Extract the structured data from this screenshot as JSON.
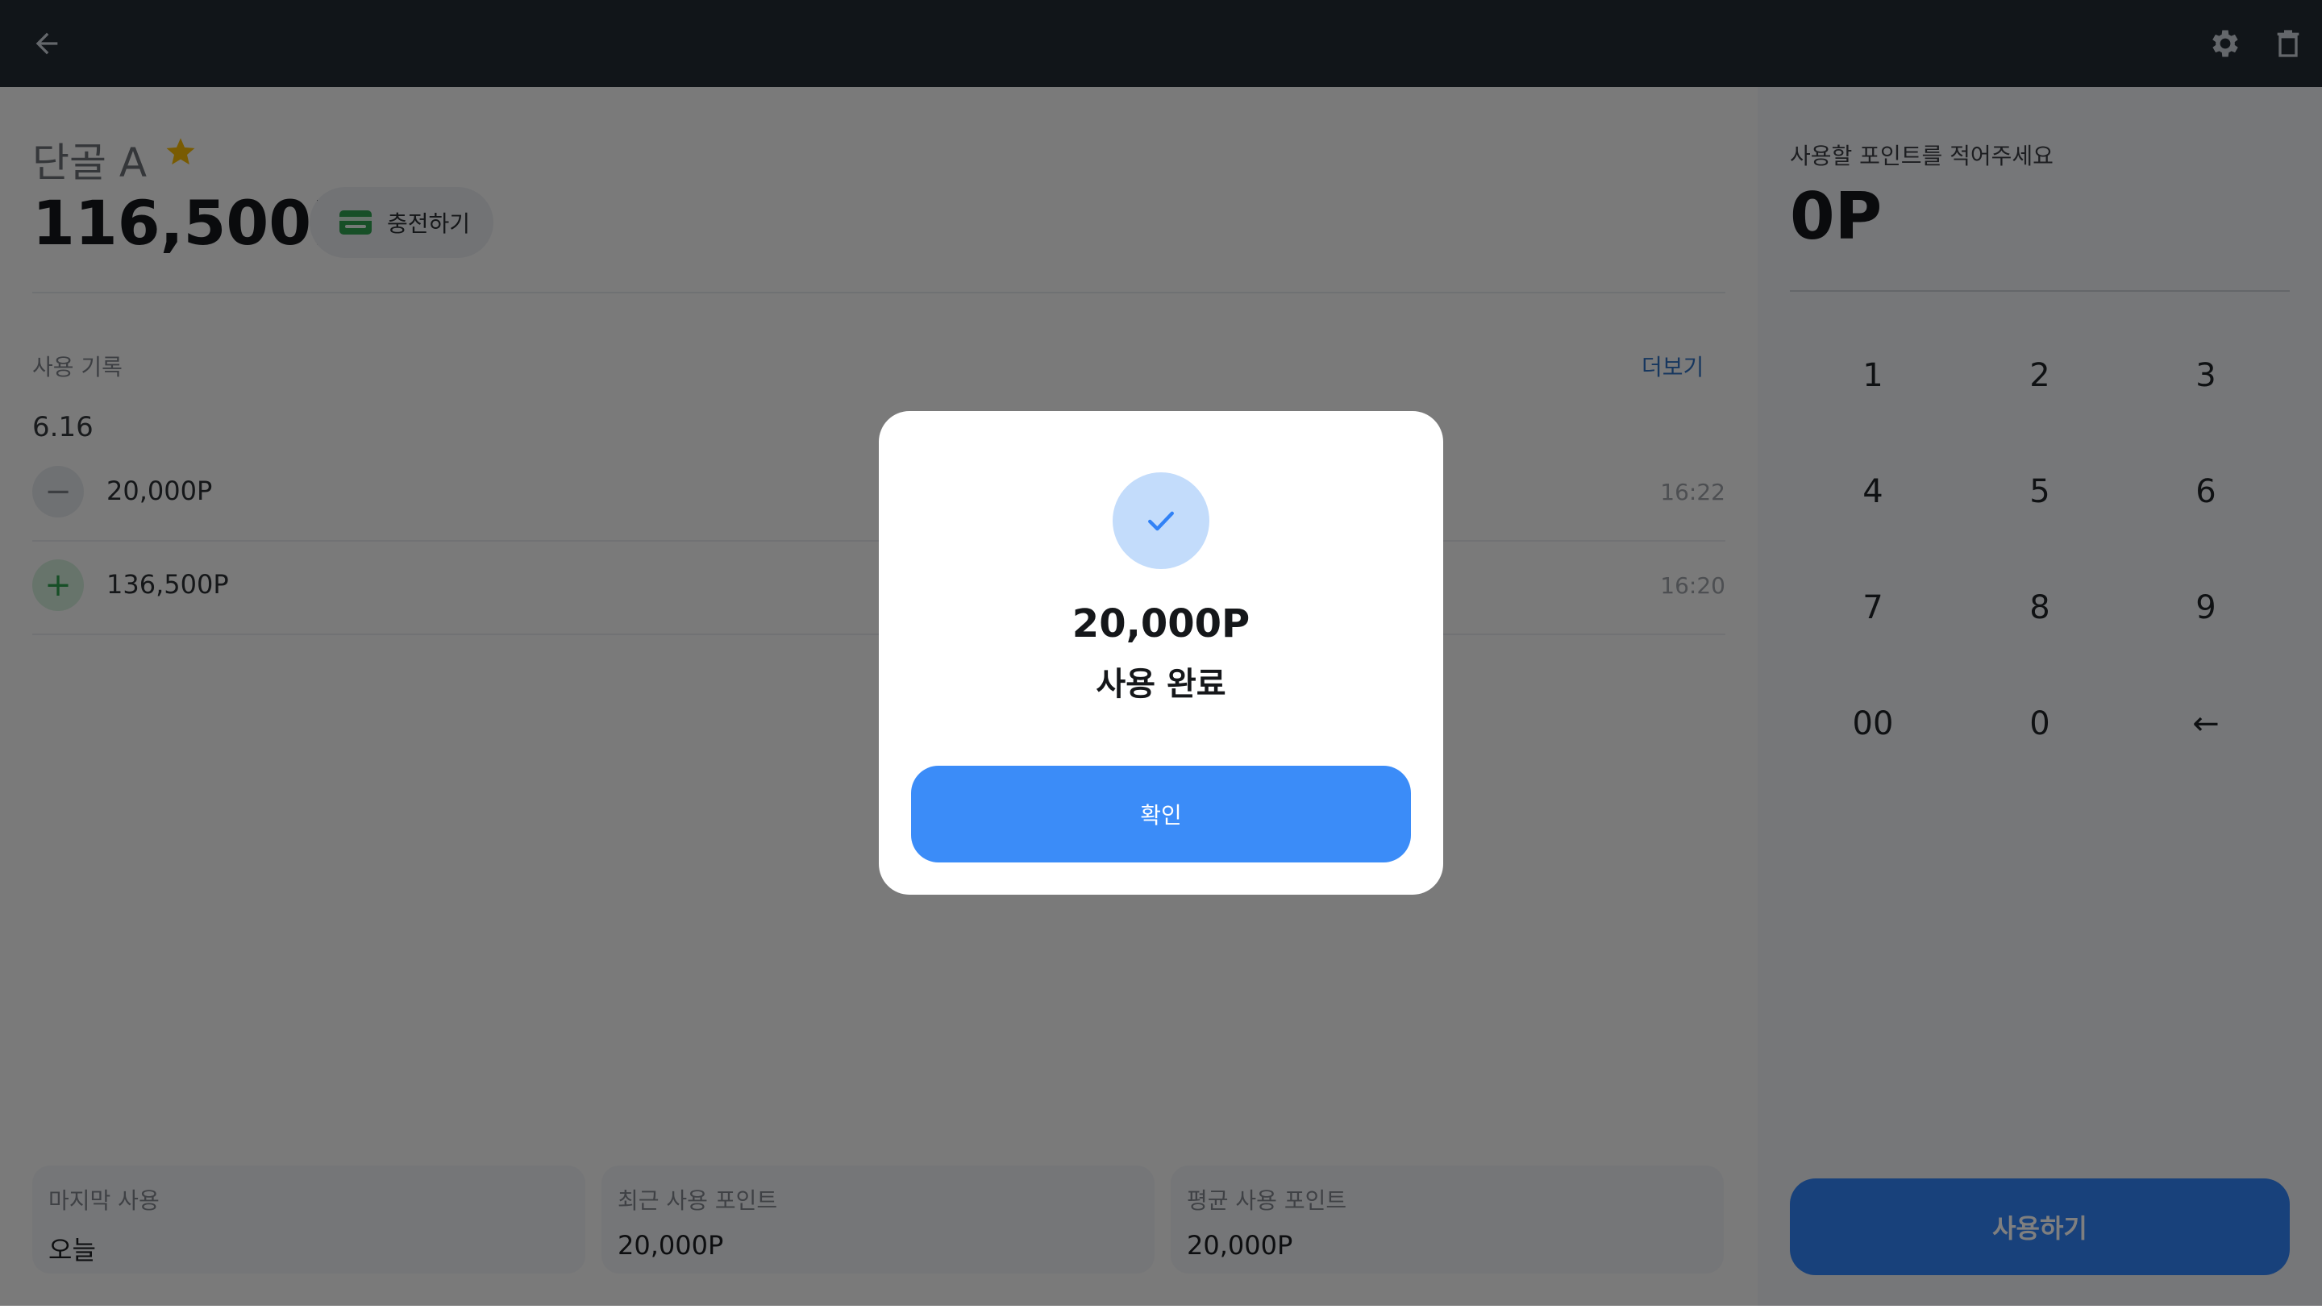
{
  "topbar": {
    "back_icon": "arrow-left-icon",
    "settings_icon": "gear-icon",
    "delete_icon": "trash-icon"
  },
  "customer": {
    "name": "단골 A",
    "favorite_icon": "star-icon",
    "balance": "116,500P",
    "charge_label": "충전하기",
    "charge_icon": "wallet-icon"
  },
  "history": {
    "title": "사용 기록",
    "more_label": "더보기",
    "date": "6.16",
    "rows": [
      {
        "type": "use",
        "symbol": "−",
        "amount": "20,000P",
        "time": "16:22"
      },
      {
        "type": "charge",
        "symbol": "+",
        "amount": "136,500P",
        "time": "16:20"
      }
    ]
  },
  "stats": [
    {
      "label": "마지막 사용",
      "value": "오늘"
    },
    {
      "label": "최근 사용 포인트",
      "value": "20,000P"
    },
    {
      "label": "평균 사용 포인트",
      "value": "20,000P"
    }
  ],
  "keypad": {
    "prompt": "사용할 포인트를 적어주세요",
    "entered": "0P",
    "keys": [
      "1",
      "2",
      "3",
      "4",
      "5",
      "6",
      "7",
      "8",
      "9",
      "00",
      "0",
      "←"
    ],
    "submit_label": "사용하기"
  },
  "modal": {
    "icon": "check-icon",
    "amount": "20,000P",
    "status": "사용 완료",
    "confirm_label": "확인"
  },
  "colors": {
    "topbar": "#222a33",
    "accent": "#3182f6",
    "star": "#f2b705",
    "charge_green": "#2e9e4f",
    "check_bg": "#c3dcfb",
    "link": "#2f6fbf"
  }
}
